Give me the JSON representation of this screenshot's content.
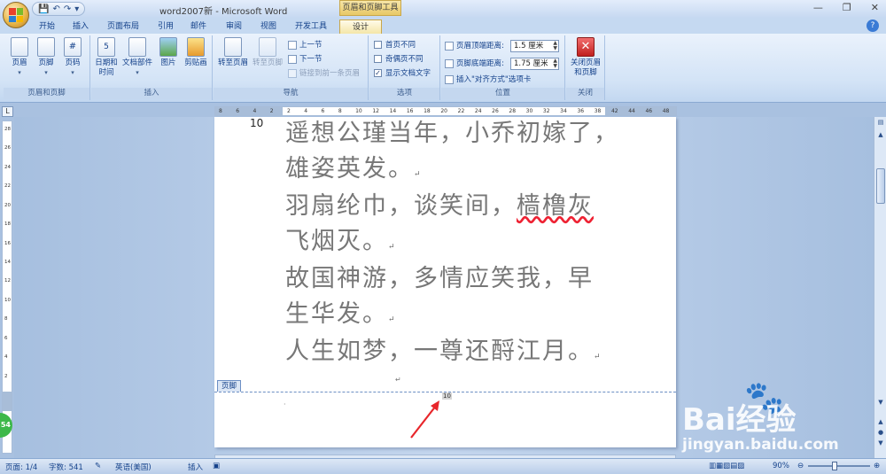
{
  "window": {
    "title": "word2007新 - Microsoft Word",
    "contextual_title": "页眉和页脚工具"
  },
  "qat": {
    "save": "💾",
    "undo": "↶",
    "redo": "↷",
    "more": "▾"
  },
  "tabs": [
    "开始",
    "插入",
    "页面布局",
    "引用",
    "邮件",
    "审阅",
    "视图",
    "开发工具",
    "设计"
  ],
  "active_tab": "设计",
  "ribbon": {
    "groups": {
      "header_footer": {
        "label": "页眉和页脚",
        "header": "页眉",
        "footer": "页脚",
        "page_number": "页码"
      },
      "insert": {
        "label": "插入",
        "date_time": "日期和\n时间",
        "doc_parts": "文档部件",
        "picture": "图片",
        "clipart": "剪贴画"
      },
      "navigation": {
        "label": "导航",
        "goto_header": "转至页眉",
        "goto_footer": "转至页脚",
        "prev": "上一节",
        "next": "下一节",
        "link_prev": "链接到前一条页眉"
      },
      "options": {
        "label": "选项",
        "diff_first": "首页不同",
        "diff_odd_even": "奇偶页不同",
        "show_doc_text": "显示文档文字"
      },
      "position": {
        "label": "位置",
        "header_top_label": "页眉顶端距离:",
        "header_top_value": "1.5 厘米",
        "footer_bottom_label": "页脚底端距离:",
        "footer_bottom_value": "1.75 厘米",
        "insert_align_tab": "插入\"对齐方式\"选项卡"
      },
      "close": {
        "label": "关闭",
        "close_btn": "关闭页眉\n和页脚"
      }
    }
  },
  "ruler": {
    "h_ticks": [
      "8",
      "6",
      "4",
      "2",
      "2",
      "4",
      "6",
      "8",
      "10",
      "12",
      "14",
      "16",
      "18",
      "20",
      "22",
      "24",
      "26",
      "28",
      "30",
      "32",
      "34",
      "36",
      "38",
      "42",
      "44",
      "46",
      "48"
    ],
    "v_ticks": [
      "28",
      "26",
      "24",
      "22",
      "20",
      "18",
      "16",
      "14",
      "12",
      "10",
      "8",
      "6",
      "4",
      "2"
    ]
  },
  "document": {
    "page_number_top": "10",
    "lines": [
      "遥想公瑾当年，小乔初嫁了，",
      "雄姿英发。",
      "羽扇纶巾，谈笑间，樯橹灰",
      "飞烟灭。",
      "故国神游，多情应笑我，早",
      "生华发。",
      "人生如梦，一尊还酹江月。"
    ],
    "misspelled": "樯橹灰",
    "footer_tag": "页脚",
    "footer_page_number": "10",
    "return_mark": "↵"
  },
  "statusbar": {
    "page": "页面: 1/4",
    "words": "字数: 541",
    "language": "英语(美国)",
    "mode": "插入",
    "zoom": "90%"
  },
  "watermark": {
    "brand": "Bai经验",
    "url": "jingyan.baidu.com"
  },
  "badge": {
    "value": "54"
  }
}
